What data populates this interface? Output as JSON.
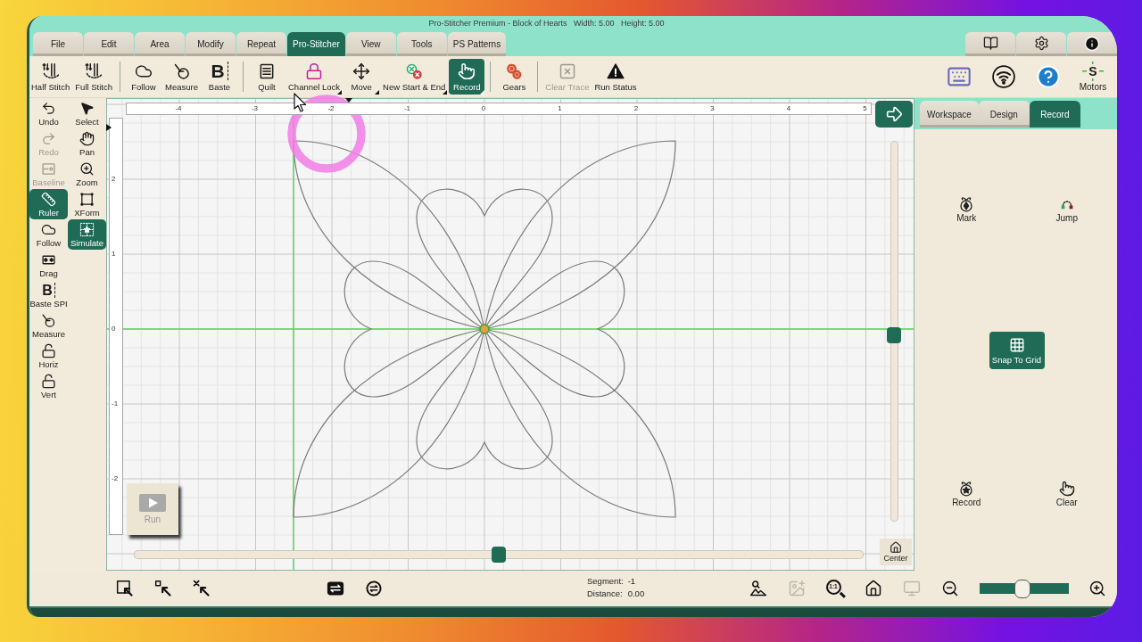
{
  "window": {
    "title": "Pro-Stitcher Premium - Block of Hearts   Width: 5.00   Height: 5.00"
  },
  "menu_tabs": [
    {
      "label": "File",
      "selected": false
    },
    {
      "label": "Edit",
      "selected": false
    },
    {
      "label": "Area",
      "selected": false
    },
    {
      "label": "Modify",
      "selected": false
    },
    {
      "label": "Repeat",
      "selected": false
    },
    {
      "label": "Pro-Stitcher",
      "selected": true
    },
    {
      "label": "View",
      "selected": false
    },
    {
      "label": "Tools",
      "selected": false
    },
    {
      "label": "PS Patterns",
      "selected": false
    }
  ],
  "menu_icons": [
    {
      "kind": "manual"
    },
    {
      "kind": "settings"
    },
    {
      "kind": "info"
    }
  ],
  "toolbar": {
    "groups": [
      [
        {
          "kind": "half_stitch",
          "label": "Half Stitch",
          "selected": false,
          "disabled": false,
          "menu": false
        },
        {
          "kind": "full_stitch",
          "label": "Full Stitch",
          "selected": false,
          "disabled": false,
          "menu": false
        }
      ],
      [
        {
          "kind": "follow",
          "label": "Follow",
          "selected": false,
          "disabled": false,
          "menu": false
        },
        {
          "kind": "measure",
          "label": "Measure",
          "selected": false,
          "disabled": false,
          "menu": false
        },
        {
          "kind": "baste",
          "glyph": "B",
          "label": "Baste",
          "selected": false,
          "disabled": false,
          "menu": false
        }
      ],
      [
        {
          "kind": "quilt",
          "label": "Quilt",
          "selected": false,
          "disabled": false,
          "menu": false
        },
        {
          "kind": "channel_lock",
          "label": "Channel Lock",
          "selected": false,
          "disabled": false,
          "menu": true
        },
        {
          "kind": "move",
          "label": "Move",
          "selected": false,
          "disabled": false,
          "menu": true
        },
        {
          "kind": "new_start_end",
          "label": "New Start & End",
          "selected": false,
          "disabled": false,
          "menu": true
        },
        {
          "kind": "record",
          "label": "Record",
          "selected": true,
          "disabled": false,
          "menu": true
        }
      ],
      [
        {
          "kind": "gears",
          "label": "Gears",
          "selected": false,
          "disabled": false,
          "menu": false
        }
      ],
      [
        {
          "kind": "clear_trace",
          "label": "Clear Trace",
          "selected": false,
          "disabled": true,
          "menu": false
        },
        {
          "kind": "run_status",
          "label": "Run Status",
          "selected": false,
          "disabled": false,
          "menu": false
        }
      ]
    ],
    "status_icons": [
      {
        "kind": "keyboard"
      },
      {
        "kind": "wifi"
      },
      {
        "kind": "help"
      },
      {
        "kind": "motors",
        "glyph": "S",
        "label": "Motors"
      }
    ]
  },
  "tool_columns": [
    [
      {
        "kind": "undo",
        "label": "Undo",
        "selected": false,
        "disabled": false
      },
      {
        "kind": "redo",
        "label": "Redo",
        "selected": false,
        "disabled": true
      },
      {
        "kind": "baseline",
        "label": "Baseline",
        "selected": false,
        "disabled": true
      },
      {
        "kind": "ruler",
        "label": "Ruler",
        "selected": true,
        "disabled": false
      },
      {
        "kind": "follow",
        "label": "Follow",
        "selected": false,
        "disabled": false
      },
      {
        "kind": "drag",
        "label": "Drag",
        "selected": false,
        "disabled": false
      },
      {
        "kind": "baste_spi",
        "glyph": "B",
        "label": "Baste SPI",
        "selected": false,
        "disabled": false
      },
      {
        "kind": "measure",
        "label": "Measure",
        "selected": false,
        "disabled": false
      },
      {
        "kind": "horiz",
        "label": "Horiz",
        "selected": false,
        "disabled": false
      },
      {
        "kind": "vert",
        "label": "Vert",
        "selected": false,
        "disabled": false
      }
    ],
    [
      {
        "kind": "select",
        "label": "Select",
        "selected": false,
        "disabled": false
      },
      {
        "kind": "pan",
        "label": "Pan",
        "selected": false,
        "disabled": false
      },
      {
        "kind": "zoom",
        "label": "Zoom",
        "selected": false,
        "disabled": false
      },
      {
        "kind": "xform",
        "label": "XForm",
        "selected": false,
        "disabled": false
      },
      {
        "kind": "simulate",
        "label": "Simulate",
        "selected": true,
        "disabled": false
      }
    ]
  ],
  "canvas": {
    "x_ruler": [
      "-4",
      "-3",
      "-2",
      "-1",
      "0",
      "1",
      "2",
      "3",
      "4",
      "5"
    ],
    "y_ruler": [
      "2",
      "1",
      "0",
      "-1",
      "-2"
    ],
    "vertical_slider": {
      "level": 0.49
    },
    "horizontal_slider": {
      "level": 0.5
    },
    "run_button": {
      "label": "Run",
      "disabled": true
    },
    "center_button": {
      "label": "Center"
    }
  },
  "side_panel": {
    "tabs": [
      {
        "label": "Workspace",
        "selected": false
      },
      {
        "label": "Design",
        "selected": false
      },
      {
        "label": "Record",
        "selected": true
      }
    ],
    "top_actions": [
      {
        "kind": "mark",
        "label": "Mark"
      },
      {
        "kind": "jump",
        "label": "Jump"
      }
    ],
    "snap_to_grid": {
      "label": "Snap To Grid",
      "on": true
    },
    "bottom_actions": [
      {
        "kind": "record",
        "label": "Record"
      },
      {
        "kind": "clear",
        "label": "Clear"
      }
    ]
  },
  "bottom_bar": {
    "selection_tools": [
      {
        "kind": "box_select"
      },
      {
        "kind": "point_select"
      },
      {
        "kind": "deselect"
      }
    ],
    "transfer_tools": [
      {
        "kind": "panel_arrows"
      },
      {
        "kind": "badge_arrows"
      }
    ],
    "readouts": [
      {
        "label": "Segment:",
        "value": "-1"
      },
      {
        "label": "Distance:",
        "value": "0.00"
      }
    ],
    "view_tools": [
      {
        "kind": "image_zoom",
        "disabled": false
      },
      {
        "kind": "image_add",
        "disabled": true
      },
      {
        "kind": "actual_size",
        "glyph": "1:1",
        "disabled": false
      },
      {
        "kind": "home",
        "disabled": false
      },
      {
        "kind": "monitor",
        "disabled": true
      },
      {
        "kind": "zoom_out",
        "disabled": false
      }
    ],
    "zoom_slider": {
      "level": 0.48
    }
  }
}
